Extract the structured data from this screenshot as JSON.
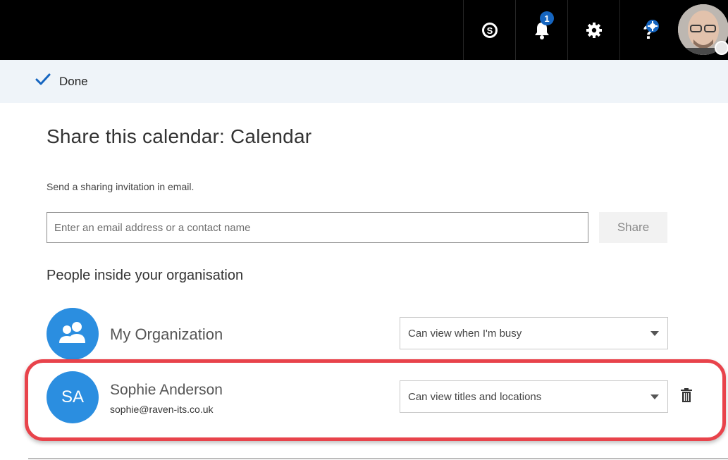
{
  "topbar": {
    "icons": [
      "skype-icon",
      "bell-icon",
      "gear-icon",
      "help-icon",
      "avatar"
    ],
    "notification_count": "1",
    "bg_color": "#000000"
  },
  "command_bar": {
    "done_label": "Done",
    "accent": "#1565c0"
  },
  "dialog": {
    "title": "Share this calendar: Calendar",
    "subtitle": "Send a sharing invitation in email.",
    "email_placeholder": "Enter an email address or a contact name",
    "email_value": "",
    "share_label": "Share",
    "section_heading": "People inside your organisation"
  },
  "people": [
    {
      "name": "My Organization",
      "email": "",
      "avatar_icon": "group-icon",
      "permission": "Can view when I'm busy"
    },
    {
      "name": "Sophie Anderson",
      "initials": "SA",
      "email": "sophie@raven-its.co.uk",
      "permission": "Can view titles and locations",
      "highlighted": true
    }
  ],
  "colors": {
    "avatar_blue": "#2b8ee0",
    "highlight_red": "#e8434b",
    "command_bar_bg": "#eff4f9"
  }
}
